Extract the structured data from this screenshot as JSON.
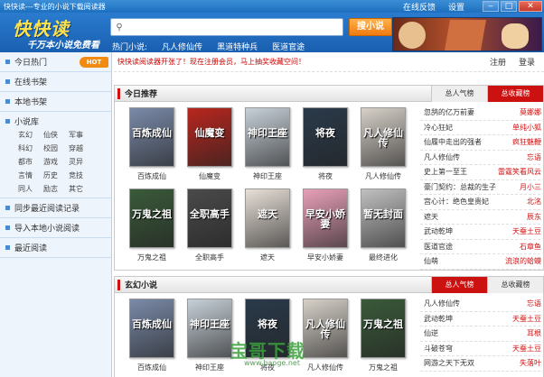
{
  "window": {
    "title": "快快读---专业的小说下载阅读器",
    "links": [
      "在线反馈",
      "设置"
    ],
    "buttons": [
      "‒",
      "□",
      "✕"
    ]
  },
  "header": {
    "logo": "快快读",
    "slogan": "千万本小说免费看",
    "search_placeholder": "",
    "search_button": "搜小说",
    "hot_label": "热门小说:",
    "hot_words": [
      "凡人修仙传",
      "黑道特种兵",
      "医道官途"
    ]
  },
  "sidebar": {
    "items_top": [
      {
        "label": "今日热门",
        "badge": "HOT"
      },
      {
        "label": "在线书架"
      },
      {
        "label": "本地书架"
      }
    ],
    "library": {
      "title": "小说库",
      "genres": [
        "玄幻",
        "仙侠",
        "军事",
        "科幻",
        "校园",
        "穿越",
        "都市",
        "游戏",
        "灵异",
        "言情",
        "历史",
        "竞技",
        "同人",
        "励志",
        "其它"
      ]
    },
    "items_bottom": [
      {
        "label": "同步最近阅读记录"
      },
      {
        "label": "导入本地小说阅读"
      },
      {
        "label": "最近阅读"
      }
    ]
  },
  "notice": {
    "text": "快快读阅读器开张了！现在注册会员，马上抽奖收藏空间！",
    "register": "注册",
    "login": "登录"
  },
  "today": {
    "title": "今日推荐",
    "tabs": [
      "总人气榜",
      "总收藏榜"
    ],
    "books": [
      {
        "title": "百炼成仙",
        "cover_text": "百炼成仙",
        "color": "#7a8aa8"
      },
      {
        "title": "仙魔变",
        "cover_text": "仙魔变",
        "color": "#b8261e"
      },
      {
        "title": "神印王座",
        "cover_text": "神印王座",
        "color": "#c7d0d8"
      },
      {
        "title": "将夜",
        "cover_text": "将夜",
        "color": "#2a3a4a"
      },
      {
        "title": "凡人修仙传",
        "cover_text": "凡人修仙传",
        "color": "#d6d0c8"
      },
      {
        "title": "万鬼之祖",
        "cover_text": "万鬼之祖",
        "color": "#3a5a3a"
      },
      {
        "title": "全职高手",
        "cover_text": "全职高手",
        "color": "#4a4a4a"
      },
      {
        "title": "遮天",
        "cover_text": "遮天",
        "color": "#e8e0d8"
      },
      {
        "title": "早安小娇妻",
        "cover_text": "早安小娇妻",
        "color": "#e8a0b8"
      },
      {
        "title": "最终进化",
        "cover_text": "暂无封面",
        "color": "#c0c0c0"
      }
    ],
    "ranking": [
      {
        "name": "忽鸹的亿万前妻",
        "author": "莫娜娜"
      },
      {
        "name": "冷心狂妃",
        "author": "单纯小狐"
      },
      {
        "name": "仙履中走出的强者",
        "author": "疯狂魅鞭"
      },
      {
        "name": "凡人修仙传",
        "author": "忘语"
      },
      {
        "name": "史上第一至王",
        "author": "雷霆笑看风云"
      },
      {
        "name": "豪门契约：总裁的生子",
        "author": "月小三"
      },
      {
        "name": "宫心计：绝色皇贵妃",
        "author": "北洺"
      },
      {
        "name": "遮天",
        "author": "辰东"
      },
      {
        "name": "武动乾坤",
        "author": "天蚕土豆"
      },
      {
        "name": "医道官途",
        "author": "石章鱼"
      },
      {
        "name": "仙萌",
        "author": "流浪的蛤蟆"
      }
    ]
  },
  "fantasy": {
    "title": "玄幻小说",
    "tabs": [
      "总人气榜",
      "总收藏榜"
    ],
    "books": [
      {
        "title": "百炼成仙",
        "cover_text": "百炼成仙",
        "color": "#7a8aa8"
      },
      {
        "title": "神印王座",
        "cover_text": "神印王座",
        "color": "#c7d0d8"
      },
      {
        "title": "将夜",
        "cover_text": "将夜",
        "color": "#2a3a4a"
      },
      {
        "title": "凡人修仙传",
        "cover_text": "凡人修仙传",
        "color": "#d6d0c8"
      },
      {
        "title": "万鬼之祖",
        "cover_text": "万鬼之祖",
        "color": "#3a5a3a"
      }
    ],
    "ranking": [
      {
        "name": "凡人修仙传",
        "author": "忘语"
      },
      {
        "name": "武动乾坤",
        "author": "天蚕土豆"
      },
      {
        "name": "仙逆",
        "author": "耳根"
      },
      {
        "name": "斗破苍穹",
        "author": "天蚕土豆"
      },
      {
        "name": "网游之天下无双",
        "author": "失落叶"
      }
    ]
  },
  "watermark": {
    "text": "宝哥下载",
    "url": "www.baoge.net"
  }
}
